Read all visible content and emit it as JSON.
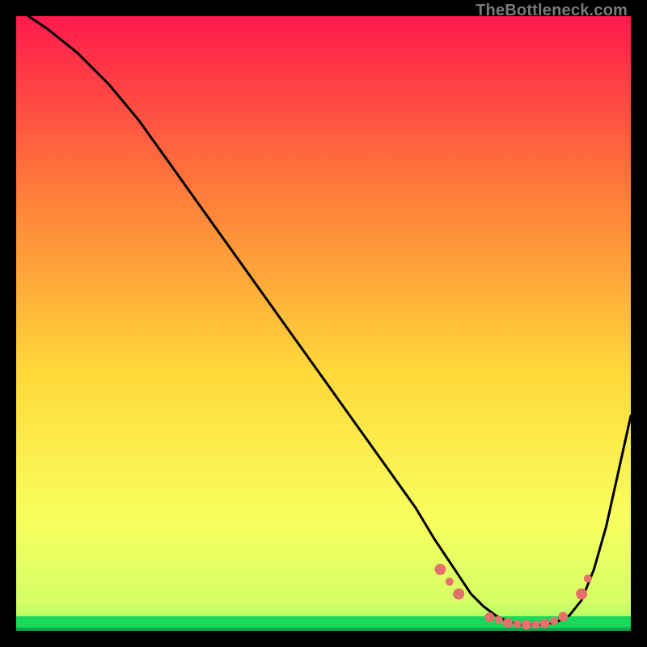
{
  "watermark": "TheBottleneck.com",
  "chart_data": {
    "type": "line",
    "title": "",
    "xlabel": "",
    "ylabel": "",
    "xlim": [
      0,
      100
    ],
    "ylim": [
      0,
      100
    ],
    "grid": false,
    "legend": false,
    "background_gradient": {
      "top": "#ff1a4d",
      "mid1": "#ff7a3a",
      "mid2": "#ffd93a",
      "mid3": "#f8ff5e",
      "bottom_band": "#17d95a",
      "bottom_line": "#0fa84a"
    },
    "series": [
      {
        "name": "bottleneck-curve",
        "color": "#000000",
        "x": [
          2,
          5,
          10,
          15,
          20,
          25,
          30,
          35,
          40,
          45,
          50,
          55,
          60,
          65,
          68,
          70,
          72,
          74,
          76,
          78,
          80,
          82,
          84,
          86,
          88,
          90,
          92,
          94,
          96,
          98,
          100
        ],
        "y": [
          100,
          98,
          94,
          89,
          83,
          76,
          69,
          62,
          55,
          48,
          41,
          34,
          27,
          20,
          15,
          12,
          9,
          6,
          4,
          2.5,
          1.5,
          1,
          1,
          1,
          1.5,
          2.5,
          5,
          10,
          17,
          26,
          35
        ]
      }
    ],
    "markers": {
      "name": "highlight-dots",
      "color": "#e4716b",
      "radius_small": 5,
      "radius_large": 7,
      "points": [
        {
          "x": 69,
          "y": 10,
          "r": 7
        },
        {
          "x": 70.5,
          "y": 8,
          "r": 5
        },
        {
          "x": 72,
          "y": 6,
          "r": 7
        },
        {
          "x": 77,
          "y": 2.2,
          "r": 6
        },
        {
          "x": 78.5,
          "y": 1.8,
          "r": 5
        },
        {
          "x": 80,
          "y": 1.3,
          "r": 6
        },
        {
          "x": 81.5,
          "y": 1.1,
          "r": 5
        },
        {
          "x": 83,
          "y": 1.0,
          "r": 6
        },
        {
          "x": 84.5,
          "y": 1.0,
          "r": 5
        },
        {
          "x": 86,
          "y": 1.2,
          "r": 6
        },
        {
          "x": 87.5,
          "y": 1.6,
          "r": 5
        },
        {
          "x": 89,
          "y": 2.3,
          "r": 6
        },
        {
          "x": 92,
          "y": 6,
          "r": 7
        },
        {
          "x": 93,
          "y": 8.5,
          "r": 5
        }
      ]
    }
  }
}
